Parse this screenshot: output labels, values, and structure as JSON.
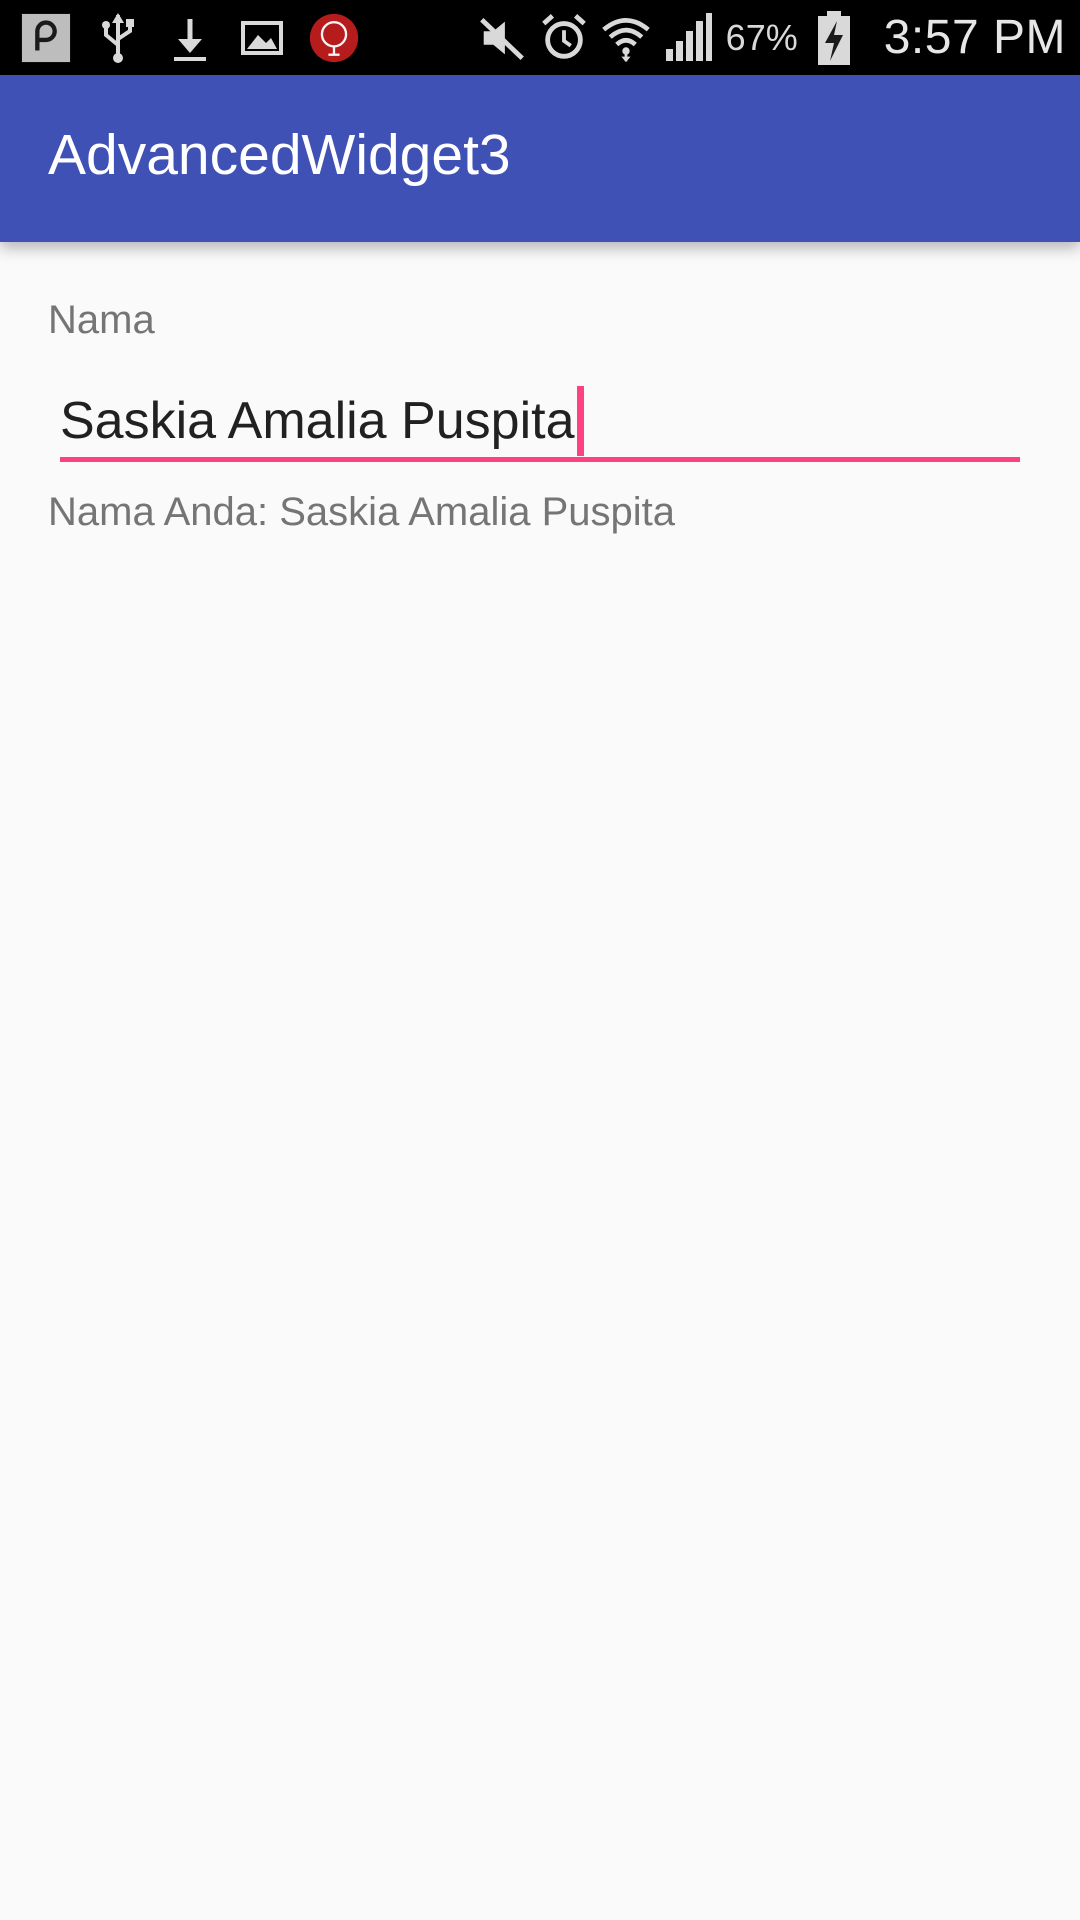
{
  "status_bar": {
    "icons_left": [
      "notification-p-icon",
      "usb-icon",
      "download-icon",
      "image-icon",
      "red-app-icon"
    ],
    "icons_right": [
      "mute-icon",
      "alarm-icon",
      "wifi-icon",
      "signal-icon",
      "battery-charging-icon"
    ],
    "battery_text": "67%",
    "clock": "3:57 PM",
    "colors": {
      "background": "#000000",
      "icon": "#d9d9d9"
    }
  },
  "app_bar": {
    "title": "AdvancedWidget3",
    "color": "#3f51b5"
  },
  "form": {
    "label": "Nama",
    "input_value": "Saskia Amalia Puspita",
    "accent_color": "#ff4081",
    "output_text": "Nama Anda: Saskia Amalia Puspita"
  }
}
